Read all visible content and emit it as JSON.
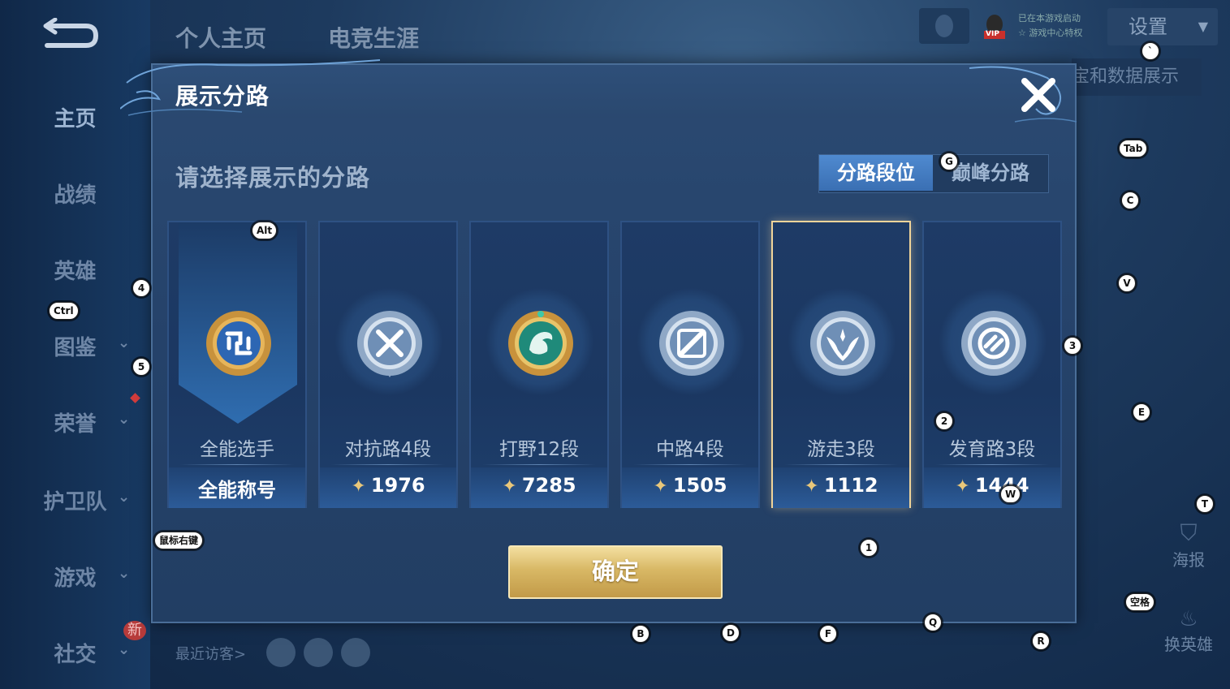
{
  "background": {
    "top_tabs": [
      "个人主页",
      "电竞生涯"
    ],
    "nav": [
      {
        "label": "主页",
        "has_chevron": false
      },
      {
        "label": "战绩",
        "has_chevron": false
      },
      {
        "label": "英雄",
        "has_chevron": false
      },
      {
        "label": "图鉴",
        "has_chevron": true
      },
      {
        "label": "荣誉",
        "has_chevron": true
      },
      {
        "label": "护卫队",
        "has_chevron": true
      },
      {
        "label": "游戏",
        "has_chevron": true
      },
      {
        "label": "社交",
        "has_chevron": true
      }
    ],
    "new_badge": "新",
    "settings_label": "设置",
    "vip_label": "VIP",
    "vip_text_line1": "已在本游戏启动",
    "vip_text_line2": "☆ 游戏中心特权",
    "data_display_label": "宝和数据展示",
    "poster_label": "海报",
    "change_hero_label": "换英雄",
    "recent_visitors_label": "最近访客>"
  },
  "dialog": {
    "title": "展示分路",
    "subtitle": "请选择展示的分路",
    "segments": [
      "分路段位",
      "巅峰分路"
    ],
    "active_segment": 0,
    "cards": [
      {
        "lane": "全能选手",
        "value": "全能称号",
        "has_gem": false,
        "selected": false,
        "emblem": "all-round-emblem-icon"
      },
      {
        "lane": "对抗路4段",
        "value": "1976",
        "has_gem": true,
        "selected": false,
        "emblem": "clash-lane-emblem-icon"
      },
      {
        "lane": "打野12段",
        "value": "7285",
        "has_gem": true,
        "selected": false,
        "emblem": "jungle-dragon-emblem-icon"
      },
      {
        "lane": "中路4段",
        "value": "1505",
        "has_gem": true,
        "selected": false,
        "emblem": "mid-lane-emblem-icon"
      },
      {
        "lane": "游走3段",
        "value": "1112",
        "has_gem": true,
        "selected": true,
        "emblem": "roam-emblem-icon"
      },
      {
        "lane": "发育路3段",
        "value": "1444",
        "has_gem": true,
        "selected": false,
        "emblem": "farm-lane-emblem-icon"
      }
    ],
    "confirm_label": "确定"
  },
  "key_hints": [
    {
      "key": "`"
    },
    {
      "key": "Tab"
    },
    {
      "key": "G"
    },
    {
      "key": "C"
    },
    {
      "key": "Alt"
    },
    {
      "key": "4"
    },
    {
      "key": "V"
    },
    {
      "key": "Ctrl"
    },
    {
      "key": "3"
    },
    {
      "key": "5"
    },
    {
      "key": "E"
    },
    {
      "key": "2"
    },
    {
      "key": "W"
    },
    {
      "key": "T"
    },
    {
      "key": "鼠标右键"
    },
    {
      "key": "1"
    },
    {
      "key": "空格"
    },
    {
      "key": "B"
    },
    {
      "key": "D"
    },
    {
      "key": "F"
    },
    {
      "key": "Q"
    },
    {
      "key": "R"
    }
  ],
  "colors": {
    "selected_border": "#f0d49a",
    "segment_active": "#4f8ad0",
    "confirm_gold": "#d8b865"
  }
}
